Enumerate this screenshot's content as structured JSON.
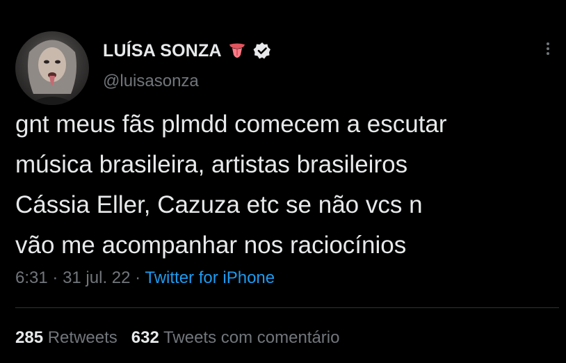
{
  "author": {
    "display_name": "LUÍSA SONZA",
    "handle": "@luisasonza",
    "name_emoji": "tongue-emoji",
    "verified": "verified-badge-icon"
  },
  "tweet": {
    "lines": [
      "gnt meus fãs plmdd comecem a escutar",
      "música brasileira, artistas brasileiros",
      "Cássia Eller, Cazuza etc se não vcs n",
      "vão me acompanhar nos raciocínios"
    ]
  },
  "meta": {
    "time": "6:31",
    "sep1": "·",
    "date": "31 jul. 22",
    "sep2": "·",
    "source": "Twitter for iPhone"
  },
  "stats": {
    "retweets_count": "285",
    "retweets_label": "Retweets",
    "quotes_count": "632",
    "quotes_label": "Tweets com comentário"
  },
  "colors": {
    "background": "#000000",
    "text": "#e7e9ea",
    "muted": "#71767b",
    "link": "#1d9bf0",
    "divider": "#2f3336"
  }
}
